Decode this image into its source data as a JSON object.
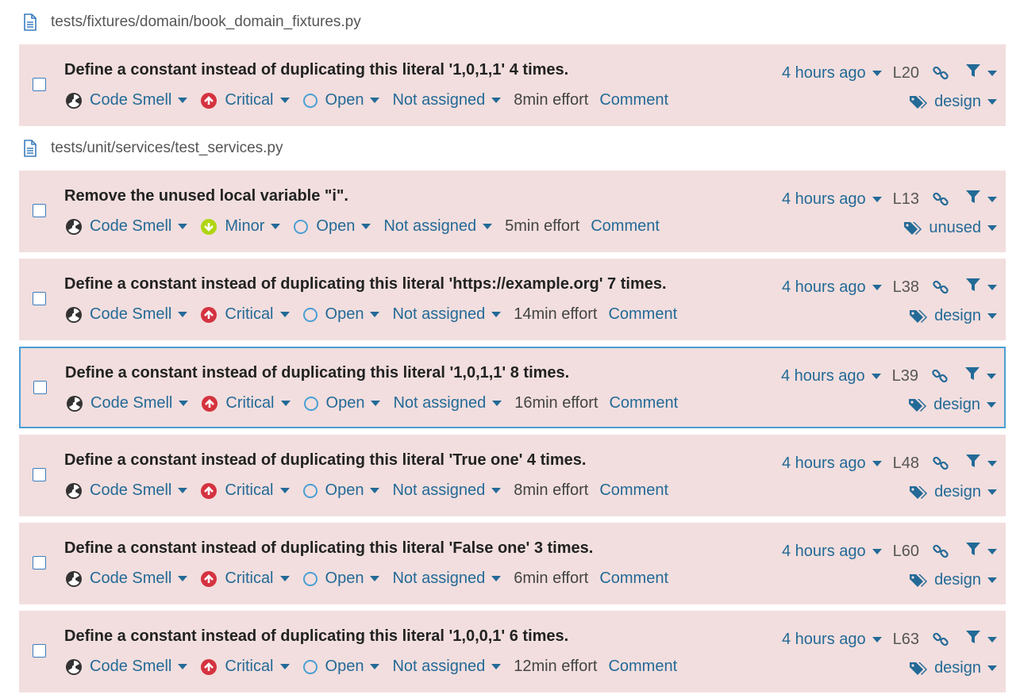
{
  "colors": {
    "row_bg": "#f2dede",
    "link": "#236a97",
    "critical": "#d4333f",
    "minor": "#b0d513",
    "selected_border": "#4b9fd5"
  },
  "groups": [
    {
      "file": "tests/fixtures/domain/book_domain_fixtures.py",
      "issues": [
        {
          "message": "Define a constant instead of duplicating this literal '1,0,1,1' 4 times.",
          "type": "Code Smell",
          "severity": "Critical",
          "severity_icon": "critical-icon",
          "status": "Open",
          "assignee": "Not assigned",
          "effort": "8min effort",
          "comment": "Comment",
          "date": "4 hours ago",
          "line": "L20",
          "tag": "design",
          "selected": false
        }
      ]
    },
    {
      "file": "tests/unit/services/test_services.py",
      "issues": [
        {
          "message": "Remove the unused local variable \"i\".",
          "type": "Code Smell",
          "severity": "Minor",
          "severity_icon": "minor-icon",
          "status": "Open",
          "assignee": "Not assigned",
          "effort": "5min effort",
          "comment": "Comment",
          "date": "4 hours ago",
          "line": "L13",
          "tag": "unused",
          "selected": false
        },
        {
          "message": "Define a constant instead of duplicating this literal 'https://example.org' 7 times.",
          "type": "Code Smell",
          "severity": "Critical",
          "severity_icon": "critical-icon",
          "status": "Open",
          "assignee": "Not assigned",
          "effort": "14min effort",
          "comment": "Comment",
          "date": "4 hours ago",
          "line": "L38",
          "tag": "design",
          "selected": false
        },
        {
          "message": "Define a constant instead of duplicating this literal '1,0,1,1' 8 times.",
          "type": "Code Smell",
          "severity": "Critical",
          "severity_icon": "critical-icon",
          "status": "Open",
          "assignee": "Not assigned",
          "effort": "16min effort",
          "comment": "Comment",
          "date": "4 hours ago",
          "line": "L39",
          "tag": "design",
          "selected": true
        },
        {
          "message": "Define a constant instead of duplicating this literal 'True one' 4 times.",
          "type": "Code Smell",
          "severity": "Critical",
          "severity_icon": "critical-icon",
          "status": "Open",
          "assignee": "Not assigned",
          "effort": "8min effort",
          "comment": "Comment",
          "date": "4 hours ago",
          "line": "L48",
          "tag": "design",
          "selected": false
        },
        {
          "message": "Define a constant instead of duplicating this literal 'False one' 3 times.",
          "type": "Code Smell",
          "severity": "Critical",
          "severity_icon": "critical-icon",
          "status": "Open",
          "assignee": "Not assigned",
          "effort": "6min effort",
          "comment": "Comment",
          "date": "4 hours ago",
          "line": "L60",
          "tag": "design",
          "selected": false
        },
        {
          "message": "Define a constant instead of duplicating this literal '1,0,0,1' 6 times.",
          "type": "Code Smell",
          "severity": "Critical",
          "severity_icon": "critical-icon",
          "status": "Open",
          "assignee": "Not assigned",
          "effort": "12min effort",
          "comment": "Comment",
          "date": "4 hours ago",
          "line": "L63",
          "tag": "design",
          "selected": false
        }
      ]
    }
  ]
}
